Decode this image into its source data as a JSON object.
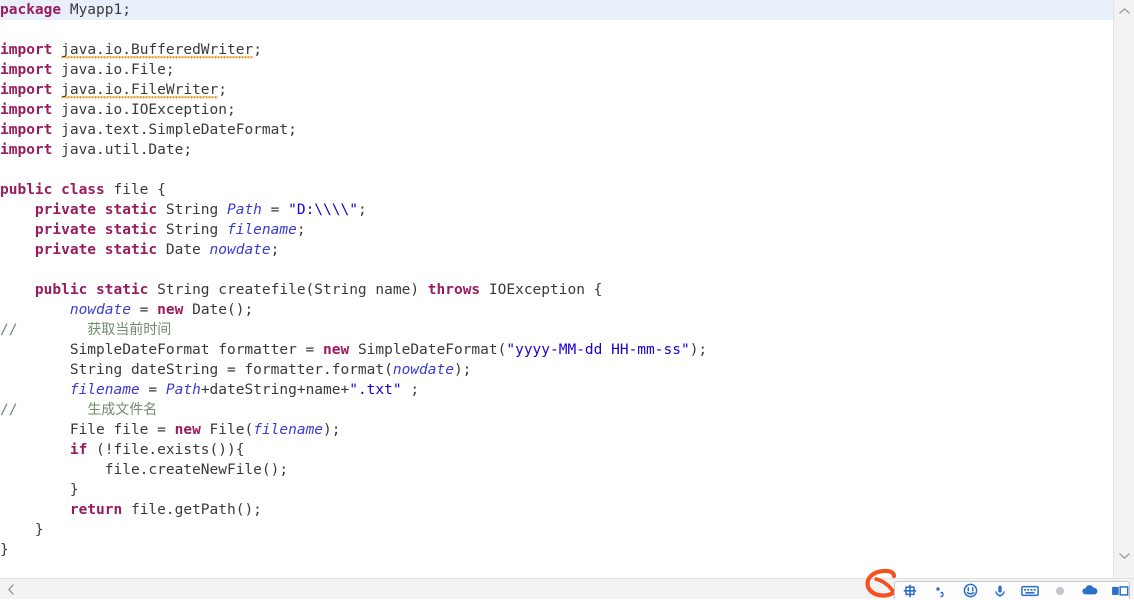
{
  "editor": {
    "language": "java",
    "background_color": "#ffffff",
    "caret_line_color": "#e9efFB",
    "keyword_color": "#9a1b5e",
    "string_color": "#1c00cf",
    "static_field_color": "#3b3bd6",
    "comment_color": "#6f8c6f",
    "warning_squiggle_color": "#e8a33d",
    "lines": [
      {
        "n": 1,
        "caret": true,
        "tokens": [
          {
            "t": "package",
            "c": "kw"
          },
          {
            "t": " Myapp1;",
            "c": "dim"
          }
        ]
      },
      {
        "n": 2,
        "caret": false,
        "tokens": []
      },
      {
        "n": 3,
        "caret": false,
        "tokens": [
          {
            "t": "import",
            "c": "kw"
          },
          {
            "t": " ",
            "c": "plain"
          },
          {
            "t": "java.io.BufferedWriter",
            "c": "dim squiggle"
          },
          {
            "t": ";",
            "c": "dim"
          }
        ]
      },
      {
        "n": 4,
        "caret": false,
        "tokens": [
          {
            "t": "import",
            "c": "kw"
          },
          {
            "t": " java.io.File;",
            "c": "dim"
          }
        ]
      },
      {
        "n": 5,
        "caret": false,
        "tokens": [
          {
            "t": "import",
            "c": "kw"
          },
          {
            "t": " ",
            "c": "plain"
          },
          {
            "t": "java.io.FileWriter",
            "c": "dim squiggle"
          },
          {
            "t": ";",
            "c": "dim"
          }
        ]
      },
      {
        "n": 6,
        "caret": false,
        "tokens": [
          {
            "t": "import",
            "c": "kw"
          },
          {
            "t": " java.io.IOException;",
            "c": "dim"
          }
        ]
      },
      {
        "n": 7,
        "caret": false,
        "tokens": [
          {
            "t": "import",
            "c": "kw"
          },
          {
            "t": " java.text.SimpleDateFormat;",
            "c": "dim"
          }
        ]
      },
      {
        "n": 8,
        "caret": false,
        "tokens": [
          {
            "t": "import",
            "c": "kw"
          },
          {
            "t": " java.util.Date;",
            "c": "dim"
          }
        ]
      },
      {
        "n": 9,
        "caret": false,
        "tokens": []
      },
      {
        "n": 10,
        "caret": false,
        "tokens": [
          {
            "t": "public class",
            "c": "kw"
          },
          {
            "t": " file {",
            "c": "dim"
          }
        ]
      },
      {
        "n": 11,
        "caret": false,
        "tokens": [
          {
            "t": "    ",
            "c": "plain"
          },
          {
            "t": "private static",
            "c": "kw"
          },
          {
            "t": " String ",
            "c": "dim"
          },
          {
            "t": "Path",
            "c": "fieldst"
          },
          {
            "t": " = ",
            "c": "dim"
          },
          {
            "t": "\"D:\\\\\\\\\"",
            "c": "str"
          },
          {
            "t": ";",
            "c": "dim"
          }
        ]
      },
      {
        "n": 12,
        "caret": false,
        "tokens": [
          {
            "t": "    ",
            "c": "plain"
          },
          {
            "t": "private static",
            "c": "kw"
          },
          {
            "t": " String ",
            "c": "dim"
          },
          {
            "t": "filename",
            "c": "fieldst"
          },
          {
            "t": ";",
            "c": "dim"
          }
        ]
      },
      {
        "n": 13,
        "caret": false,
        "tokens": [
          {
            "t": "    ",
            "c": "plain"
          },
          {
            "t": "private static",
            "c": "kw"
          },
          {
            "t": " Date ",
            "c": "dim"
          },
          {
            "t": "nowdate",
            "c": "fieldst"
          },
          {
            "t": ";",
            "c": "dim"
          }
        ]
      },
      {
        "n": 14,
        "caret": false,
        "tokens": []
      },
      {
        "n": 15,
        "caret": false,
        "tokens": [
          {
            "t": "    ",
            "c": "plain"
          },
          {
            "t": "public static",
            "c": "kw"
          },
          {
            "t": " String createfile(String name) ",
            "c": "dim"
          },
          {
            "t": "throws",
            "c": "kw"
          },
          {
            "t": " IOException {",
            "c": "dim"
          }
        ]
      },
      {
        "n": 16,
        "caret": false,
        "tokens": [
          {
            "t": "        ",
            "c": "plain"
          },
          {
            "t": "nowdate",
            "c": "fieldst"
          },
          {
            "t": " = ",
            "c": "dim"
          },
          {
            "t": "new",
            "c": "kw"
          },
          {
            "t": " Date();",
            "c": "dim"
          }
        ]
      },
      {
        "n": 17,
        "caret": false,
        "tokens": [
          {
            "t": "//",
            "c": "comment"
          },
          {
            "t": "        ",
            "c": "plain"
          },
          {
            "t": "获取当前时间",
            "c": "comment-cjk"
          }
        ]
      },
      {
        "n": 18,
        "caret": false,
        "tokens": [
          {
            "t": "        SimpleDateFormat formatter = ",
            "c": "dim"
          },
          {
            "t": "new",
            "c": "kw"
          },
          {
            "t": " SimpleDateFormat(",
            "c": "dim"
          },
          {
            "t": "\"yyyy-MM-dd HH-mm-ss\"",
            "c": "str"
          },
          {
            "t": ");",
            "c": "dim"
          }
        ]
      },
      {
        "n": 19,
        "caret": false,
        "tokens": [
          {
            "t": "        String dateString = formatter.format(",
            "c": "dim"
          },
          {
            "t": "nowdate",
            "c": "fieldst"
          },
          {
            "t": ");",
            "c": "dim"
          }
        ]
      },
      {
        "n": 20,
        "caret": false,
        "tokens": [
          {
            "t": "        ",
            "c": "plain"
          },
          {
            "t": "filename",
            "c": "fieldst"
          },
          {
            "t": " = ",
            "c": "dim"
          },
          {
            "t": "Path",
            "c": "fieldst"
          },
          {
            "t": "+dateString+name+",
            "c": "dim"
          },
          {
            "t": "\".txt\"",
            "c": "str"
          },
          {
            "t": " ;",
            "c": "dim"
          }
        ]
      },
      {
        "n": 21,
        "caret": false,
        "tokens": [
          {
            "t": "//",
            "c": "comment"
          },
          {
            "t": "        ",
            "c": "plain"
          },
          {
            "t": "生成文件名",
            "c": "comment-cjk"
          }
        ]
      },
      {
        "n": 22,
        "caret": false,
        "tokens": [
          {
            "t": "        File file = ",
            "c": "dim"
          },
          {
            "t": "new",
            "c": "kw"
          },
          {
            "t": " File(",
            "c": "dim"
          },
          {
            "t": "filename",
            "c": "fieldst"
          },
          {
            "t": ");",
            "c": "dim"
          }
        ]
      },
      {
        "n": 23,
        "caret": false,
        "tokens": [
          {
            "t": "        ",
            "c": "plain"
          },
          {
            "t": "if",
            "c": "kw"
          },
          {
            "t": " (!file.exists()){",
            "c": "dim"
          }
        ]
      },
      {
        "n": 24,
        "caret": false,
        "tokens": [
          {
            "t": "            file.createNewFile();",
            "c": "dim"
          }
        ]
      },
      {
        "n": 25,
        "caret": false,
        "tokens": [
          {
            "t": "        }",
            "c": "dim"
          }
        ]
      },
      {
        "n": 26,
        "caret": false,
        "tokens": [
          {
            "t": "        ",
            "c": "plain"
          },
          {
            "t": "return",
            "c": "kw"
          },
          {
            "t": " file.getPath();",
            "c": "dim"
          }
        ]
      },
      {
        "n": 27,
        "caret": false,
        "tokens": [
          {
            "t": "    }",
            "c": "dim"
          }
        ]
      },
      {
        "n": 28,
        "caret": false,
        "tokens": [
          {
            "t": "}",
            "c": "dim"
          }
        ]
      }
    ]
  },
  "scrollbars": {
    "vertical": {
      "up_arrow_icon": "chevron-up-icon",
      "down_arrow_icon": "chevron-down-icon",
      "track_color": "#f3f3f3"
    },
    "horizontal": {
      "left_arrow_icon": "chevron-left-icon",
      "track_color": "#f3f3f3"
    }
  },
  "ime_toolbar": {
    "name": "sogou-input-method-toolbar",
    "logo_icon": "sogou-logo-icon",
    "logo_color": "#f4511e",
    "accent_color": "#2a6fc9",
    "buttons": [
      {
        "icon": "chinese-english-toggle-icon",
        "label": "中"
      },
      {
        "icon": "fullwidth-halfwidth-icon",
        "label": ","
      },
      {
        "icon": "emoji-expression-icon",
        "label": ""
      },
      {
        "icon": "voice-input-icon",
        "label": ""
      },
      {
        "icon": "soft-keyboard-icon",
        "label": ""
      },
      {
        "icon": "toolbox-dot-icon",
        "label": ""
      },
      {
        "icon": "cloud-sync-icon",
        "label": ""
      },
      {
        "icon": "skin-panel-icon",
        "label": ""
      }
    ]
  }
}
